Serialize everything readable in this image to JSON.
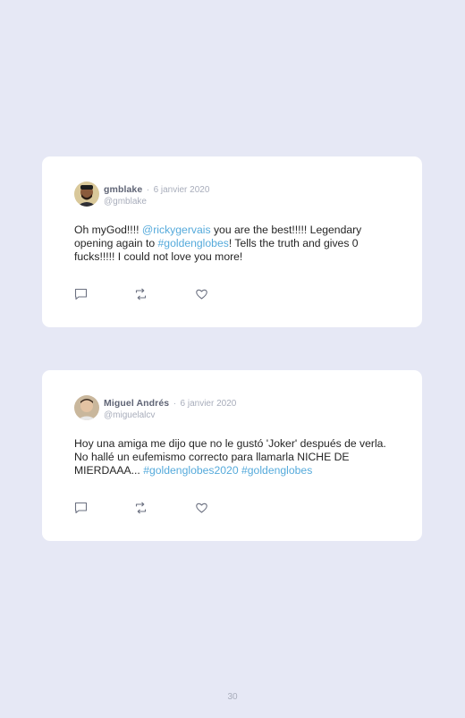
{
  "tweets": [
    {
      "name": "gmblake",
      "separator": "·",
      "date": "6 janvier 2020",
      "handle": "@gmblake",
      "text_parts": [
        {
          "t": "Oh myGod!!!! "
        },
        {
          "t": "@rickygervais",
          "link": true
        },
        {
          "t": " you are the best!!!!! Legendary opening again to "
        },
        {
          "t": "#goldenglobes",
          "link": true
        },
        {
          "t": "! Tells the truth and gives 0 fucks!!!!! I could not love you more!"
        }
      ],
      "actions": [
        "comment-icon",
        "retweet-icon",
        "like-icon"
      ]
    },
    {
      "name": "Miguel Andrés",
      "separator": "·",
      "date": "6 janvier 2020",
      "handle": "@miguelalcv",
      "text_parts": [
        {
          "t": "Hoy una amiga me dijo que no le gustó 'Joker' después de verla. No hallé un eufemismo correcto para llamarla NICHE DE MIERDAAA... "
        },
        {
          "t": "#goldenglobes2020",
          "link": true
        },
        {
          "t": " "
        },
        {
          "t": "#goldenglobes",
          "link": true
        }
      ],
      "actions": [
        "comment-icon",
        "retweet-icon",
        "like-icon"
      ]
    }
  ],
  "colors": {
    "background": "#e6e8f5",
    "card": "#ffffff",
    "link": "#55aadb",
    "muted": "#a8adbb",
    "name": "#5f6475"
  },
  "footer": {
    "page_number": "30"
  }
}
